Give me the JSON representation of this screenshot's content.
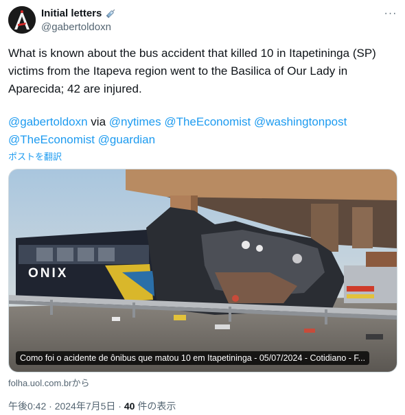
{
  "author": {
    "display_name": "Initial letters",
    "handle": "@gabertoldoxn",
    "name_icon": "syringe-emoji"
  },
  "more_label": "···",
  "tweet": {
    "text": "What is known about the bus accident that killed 10 in Itapetininga (SP) victims from the Itapeva region went to the Basilica of Our Lady in Aparecida; 42 are injured.",
    "mention_1": "@gabertoldoxn",
    "via": " via ",
    "mention_2": "@nytimes",
    "mention_3": "@TheEconomist",
    "mention_4": "@washingtonpost",
    "mention_5": "@TheEconomist",
    "mention_6": "@guardian",
    "translate": "ポストを翻訳"
  },
  "card": {
    "caption": "Como foi o acidente de ônibus que matou 10 em Itapetininga - 05/07/2024 - Cotidiano - F...",
    "bus_brand": "ONIX",
    "source": "folha.uol.com.brから"
  },
  "meta": {
    "time": "午後0:42",
    "separator": " · ",
    "date": "2024年7月5日",
    "views_count": "40",
    "views_label": " 件の表示"
  },
  "colors": {
    "link": "#1d9bf0",
    "muted": "#536471",
    "text": "#0f1419"
  }
}
